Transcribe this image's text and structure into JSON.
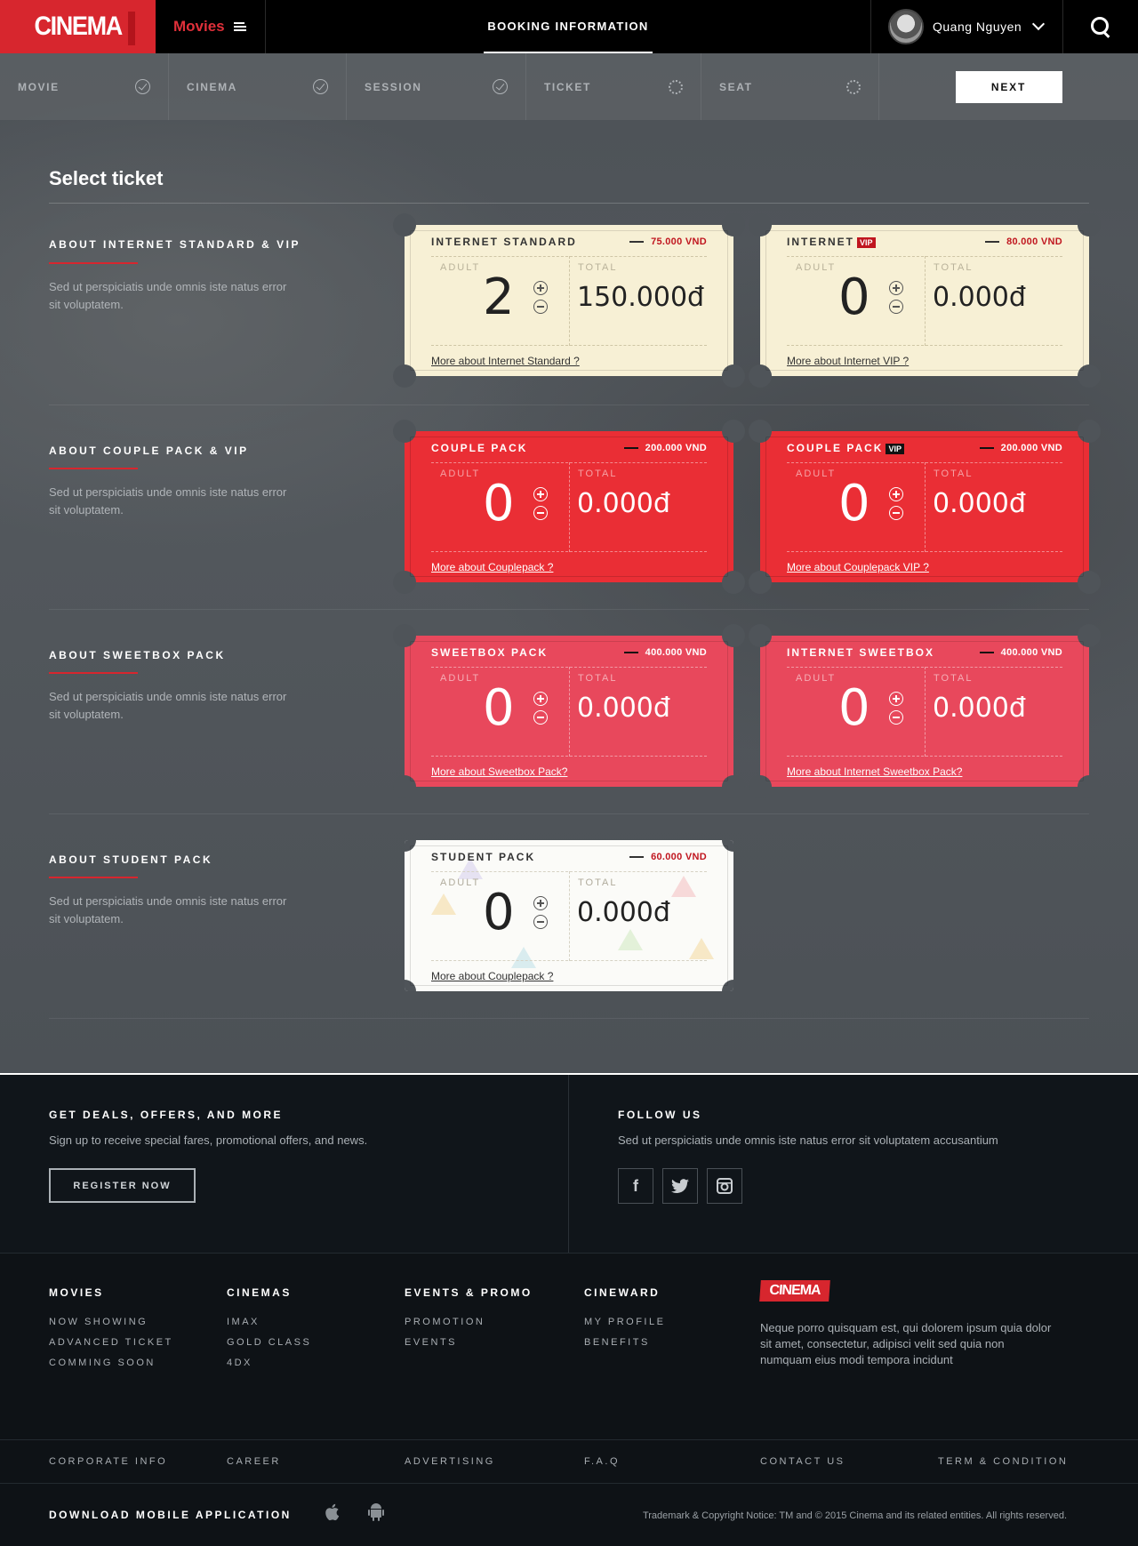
{
  "header": {
    "logo": "CINEMA",
    "movies_label": "Movies",
    "booking_title": "BOOKING INFORMATION",
    "user_name": "Quang Nguyen"
  },
  "steps": {
    "items": [
      {
        "label": "MOVIE",
        "state": "done"
      },
      {
        "label": "CINEMA",
        "state": "done"
      },
      {
        "label": "SESSION",
        "state": "done"
      },
      {
        "label": "TICKET",
        "state": "pending"
      },
      {
        "label": "SEAT",
        "state": "pending"
      }
    ],
    "next_label": "NEXT"
  },
  "main": {
    "title": "Select ticket",
    "rows": [
      {
        "title": "ABOUT INTERNET STANDARD & VIP",
        "desc": "Sed ut perspiciatis unde omnis iste natus error sit voluptatem."
      },
      {
        "title": "ABOUT COUPLE PACK & VIP",
        "desc": "Sed ut perspiciatis unde omnis iste natus error sit voluptatem."
      },
      {
        "title": "ABOUT SWEETBOX PACK",
        "desc": "Sed ut perspiciatis unde omnis iste natus error sit voluptatem."
      },
      {
        "title": "ABOUT STUDENT PACK",
        "desc": "Sed ut perspiciatis unde omnis iste natus error sit voluptatem."
      }
    ],
    "tickets": [
      {
        "name": "INTERNET STANDARD",
        "vip": "",
        "price": "75.000 VND",
        "adult_label": "ADULT",
        "total_label": "TOTAL",
        "qty": "2",
        "total": "150.000đ",
        "link": "More about Internet Standard ?"
      },
      {
        "name": "INTERNET",
        "vip": "VIP",
        "price": "80.000 VND",
        "adult_label": "ADULT",
        "total_label": "TOTAL",
        "qty": "0",
        "total": "0.000đ",
        "link": "More about Internet VIP ?"
      },
      {
        "name": "COUPLE PACK",
        "vip": "",
        "price": "200.000 VND",
        "adult_label": "ADULT",
        "total_label": "TOTAL",
        "qty": "0",
        "total": "0.000đ",
        "link": "More about Couplepack ?"
      },
      {
        "name": "COUPLE PACK",
        "vip": "VIP",
        "price": "200.000 VND",
        "adult_label": "ADULT",
        "total_label": "TOTAL",
        "qty": "0",
        "total": "0.000đ",
        "link": "More about Couplepack VIP ?"
      },
      {
        "name": "SWEETBOX PACK",
        "vip": "",
        "price": "400.000 VND",
        "adult_label": "ADULT",
        "total_label": "TOTAL",
        "qty": "0",
        "total": "0.000đ",
        "link": "More about Sweetbox Pack?"
      },
      {
        "name": "INTERNET SWEETBOX",
        "vip": "",
        "price": "400.000 VND",
        "adult_label": "ADULT",
        "total_label": "TOTAL",
        "qty": "0",
        "total": "0.000đ",
        "link": "More about Internet Sweetbox Pack?"
      },
      {
        "name": "STUDENT PACK",
        "vip": "",
        "price": "60.000 VND",
        "adult_label": "ADULT",
        "total_label": "TOTAL",
        "qty": "0",
        "total": "0.000đ",
        "link": "More about Couplepack ?"
      }
    ]
  },
  "footer": {
    "deals_title": "GET DEALS, OFFERS, AND MORE",
    "deals_text": "Sign up to receive special fares, promotional offers, and news.",
    "register_label": "REGISTER NOW",
    "follow_title": "FOLLOW US",
    "follow_text": "Sed ut perspiciatis unde omnis iste natus error sit voluptatem accusantium",
    "social": [
      "f",
      "t",
      "ig"
    ],
    "columns": [
      {
        "title": "MOVIES",
        "links": [
          "NOW SHOWING",
          "ADVANCED TICKET",
          "COMMING SOON"
        ]
      },
      {
        "title": "CINEMAS",
        "links": [
          "IMAX",
          "GOLD CLASS",
          "4DX"
        ]
      },
      {
        "title": "EVENTS & PROMO",
        "links": [
          "PROMOTION",
          "EVENTS"
        ]
      },
      {
        "title": "CINEWARD",
        "links": [
          "MY PROFILE",
          "BENEFITS"
        ]
      }
    ],
    "logo": "CINEMA",
    "about": "Neque porro quisquam est, qui dolorem ipsum quia dolor sit amet, consectetur, adipisci velit sed quia non numquam eius modi tempora incidunt",
    "bottom_links": [
      "CORPORATE INFO",
      "CAREER",
      "ADVERTISING",
      "F.A.Q",
      "CONTACT US",
      "TERM & CONDITION"
    ],
    "download_title": "DOWNLOAD MOBILE APPLICATION",
    "copyright": "Trademark & Copyright Notice: TM and © 2015 Cinema and its related entities. All rights reserved."
  },
  "colors": {
    "brand_red": "#d7262e",
    "ticket_cream": "#f7f0d5",
    "ticket_red": "#ea2e35",
    "ticket_pink": "#e8485c",
    "ticket_white": "#fbfbf8"
  }
}
